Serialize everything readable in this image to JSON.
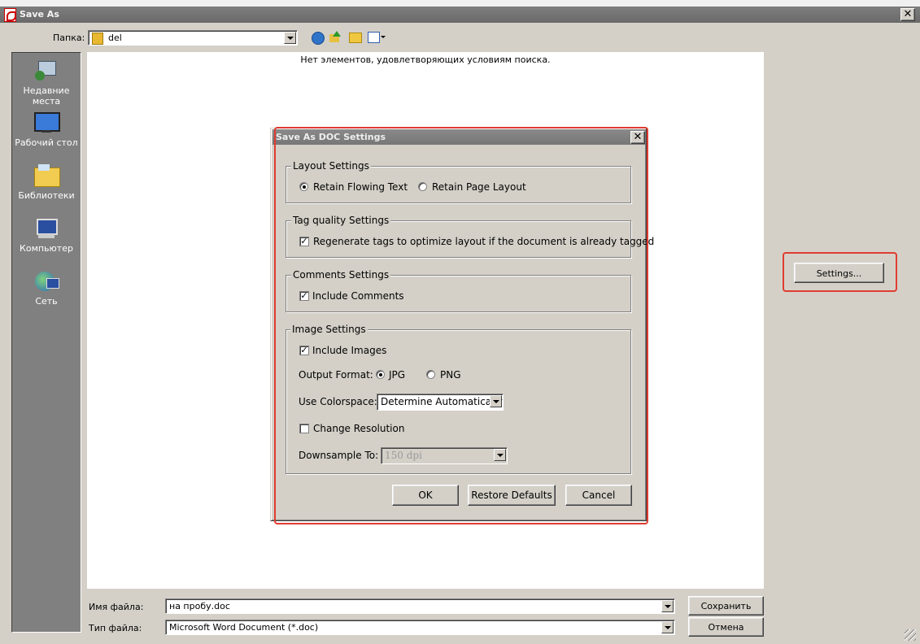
{
  "window": {
    "title": "Save As",
    "close_glyph": "✕"
  },
  "toolbar": {
    "folder_label": "Папка:",
    "folder_value": "del"
  },
  "places": [
    {
      "label": "Недавние места",
      "icon": "recent-places-icon"
    },
    {
      "label": "Рабочий стол",
      "icon": "desktop-icon"
    },
    {
      "label": "Библиотеки",
      "icon": "libraries-icon"
    },
    {
      "label": "Компьютер",
      "icon": "computer-icon"
    },
    {
      "label": "Сеть",
      "icon": "network-icon"
    }
  ],
  "file_list": {
    "empty_message": "Нет элементов, удовлетворяющих условиям поиска."
  },
  "settings_button": "Settings...",
  "bottom": {
    "filename_label": "Имя файла:",
    "filename_value": "на пробу.doc",
    "filetype_label": "Тип файла:",
    "filetype_value": "Microsoft Word Document (*.doc)",
    "save_label": "Сохранить",
    "cancel_label": "Отмена"
  },
  "dialog": {
    "title": "Save As DOC Settings",
    "layout": {
      "title": "Layout Settings",
      "option1": "Retain Flowing Text",
      "option2": "Retain Page Layout",
      "selected": "Retain Flowing Text"
    },
    "tag_quality": {
      "title": "Tag quality Settings",
      "regenerate_label": "Regenerate tags to optimize layout if the document is already tagged",
      "regenerate_checked": true
    },
    "comments": {
      "title": "Comments Settings",
      "include_label": "Include Comments",
      "include_checked": true
    },
    "image": {
      "title": "Image Settings",
      "include_label": "Include Images",
      "include_checked": true,
      "format_label": "Output Format:",
      "format_jpg": "JPG",
      "format_png": "PNG",
      "format_selected": "JPG",
      "colorspace_label": "Use Colorspace:",
      "colorspace_value": "Determine Automatically",
      "change_resolution_label": "Change Resolution",
      "change_resolution_checked": false,
      "downsample_label": "Downsample To:",
      "downsample_value": "150 dpi"
    },
    "ok_label": "OK",
    "restore_label": "Restore Defaults",
    "cancel_label": "Cancel"
  },
  "colors": {
    "highlight": "#e03c31",
    "face": "#d4d0c8",
    "places_bg": "#808080"
  }
}
